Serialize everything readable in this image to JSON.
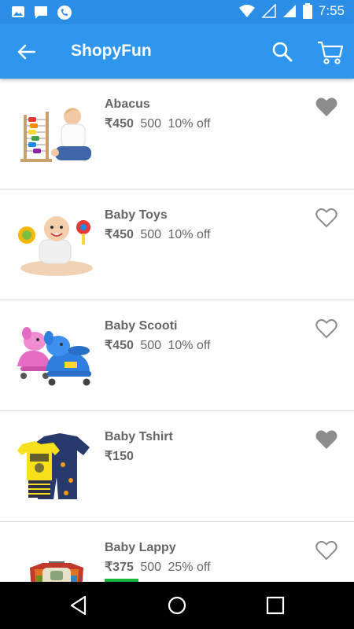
{
  "status_bar": {
    "time": "7:55",
    "left_icons": [
      "image-icon",
      "message-icon",
      "phone-icon"
    ],
    "right_icons": [
      "wifi-icon",
      "signal-icon",
      "signal-icon",
      "battery-icon"
    ]
  },
  "app_bar": {
    "title": "ShopyFun",
    "background": "#2f96ee",
    "icons": [
      "back-arrow-icon",
      "search-icon",
      "cart-icon"
    ]
  },
  "products": [
    {
      "name": "Abacus",
      "price": "₹450",
      "mrp": "500",
      "discount": "10% off",
      "favorited": true,
      "image_icon": "abacus-image"
    },
    {
      "name": "Baby Toys",
      "price": "₹450",
      "mrp": "500",
      "discount": "10% off",
      "favorited": false,
      "image_icon": "baby-toys-image"
    },
    {
      "name": "Baby Scooti",
      "price": "₹450",
      "mrp": "500",
      "discount": "10% off",
      "favorited": false,
      "image_icon": "baby-scooti-image"
    },
    {
      "name": "Baby Tshirt",
      "price": "₹150",
      "mrp": "",
      "discount": "",
      "favorited": true,
      "image_icon": "baby-tshirt-image"
    },
    {
      "name": "Baby Lappy",
      "price": "₹375",
      "mrp": "500",
      "discount": "25% off",
      "favorited": false,
      "image_icon": "baby-lappy-image"
    }
  ],
  "colors": {
    "status_bar": "#2a8ee6",
    "text_gray": "#666666",
    "heart_filled": "#8c8c8c",
    "tag_green": "#19b53b"
  },
  "nav_bar": {
    "icons": [
      "nav-back-icon",
      "nav-home-icon",
      "nav-recents-icon"
    ]
  }
}
